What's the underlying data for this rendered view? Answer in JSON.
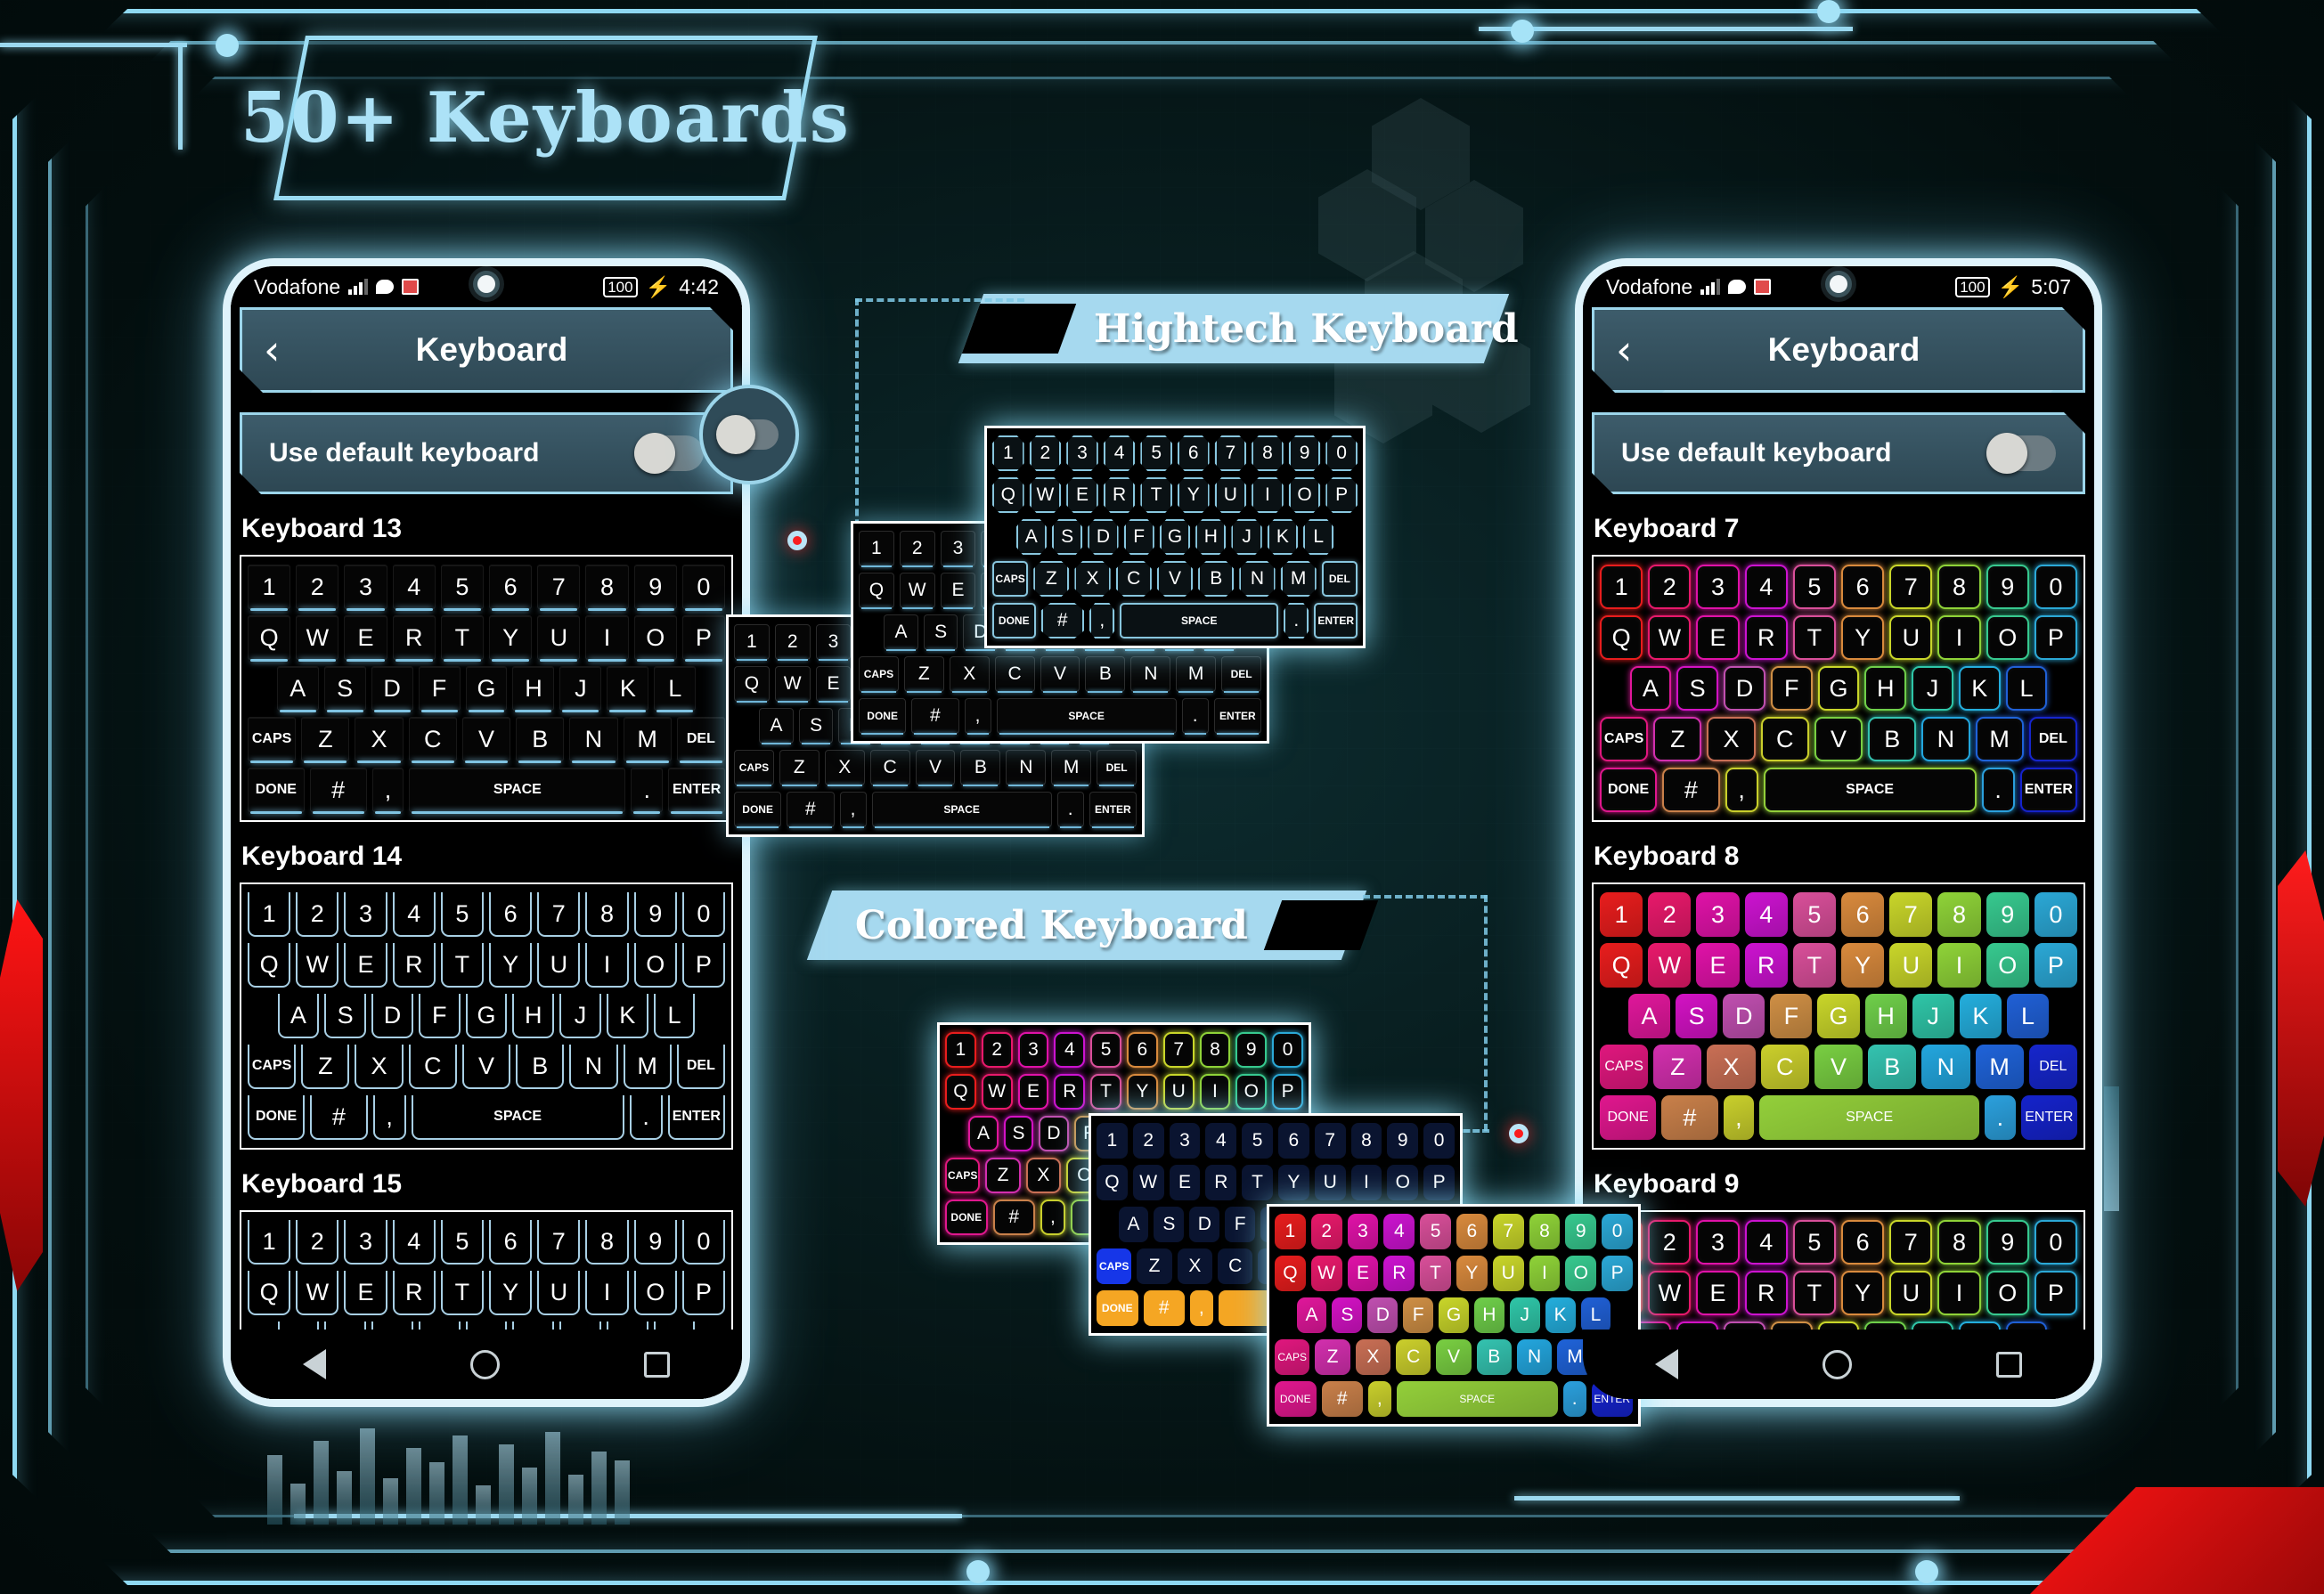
{
  "page": {
    "title": "50+ Keyboards",
    "accent_cyan": "#9bdcf3",
    "accent_red": "#ff1414",
    "bg": "#04100f"
  },
  "banners": [
    {
      "id": "hightech",
      "label": "Hightech Keyboard"
    },
    {
      "id": "colored",
      "label": "Colored Keyboard"
    }
  ],
  "phone_left": {
    "status": {
      "carrier": "Vodafone",
      "battery": "100",
      "time": "4:42"
    },
    "header": {
      "title": "Keyboard",
      "back_icon": "chevron-left-icon"
    },
    "default_row": {
      "label": "Use default keyboard",
      "toggle_state": "off"
    },
    "sections": [
      {
        "label": "Keyboard 13"
      },
      {
        "label": "Keyboard 14"
      },
      {
        "label": "Keyboard 15"
      }
    ]
  },
  "phone_right": {
    "status": {
      "carrier": "Vodafone",
      "battery": "100",
      "time": "5:07"
    },
    "header": {
      "title": "Keyboard",
      "back_icon": "chevron-left-icon"
    },
    "default_row": {
      "label": "Use default keyboard",
      "toggle_state": "off"
    },
    "sections": [
      {
        "label": "Keyboard 7"
      },
      {
        "label": "Keyboard 8"
      },
      {
        "label": "Keyboard 9"
      }
    ]
  },
  "keyboard_layout": {
    "row_numbers": [
      "1",
      "2",
      "3",
      "4",
      "5",
      "6",
      "7",
      "8",
      "9",
      "0"
    ],
    "row_top": [
      "Q",
      "W",
      "E",
      "R",
      "T",
      "Y",
      "U",
      "I",
      "O",
      "P"
    ],
    "row_home": [
      "A",
      "S",
      "D",
      "F",
      "G",
      "H",
      "J",
      "K",
      "L"
    ],
    "row_bottom": [
      "CAPS",
      "Z",
      "X",
      "C",
      "V",
      "B",
      "N",
      "M",
      "DEL"
    ],
    "row_action": [
      "DONE",
      "#",
      ",",
      "SPACE",
      ".",
      "ENTER"
    ]
  },
  "key_colors": {
    "rainbow": [
      "#e81d1d",
      "#e8196b",
      "#e012a8",
      "#cc13d0",
      "#d94f9a",
      "#d98a3d",
      "#c9d62a",
      "#8fd338",
      "#37c98f",
      "#2ba8d6"
    ],
    "rainbow_home": [
      "#e0179b",
      "#d312c4",
      "#c04fb0",
      "#cf8f45",
      "#c9d62a",
      "#6fcf4a",
      "#2fc6a8",
      "#24aedd",
      "#2060d6"
    ],
    "rainbow_bottom": [
      "#e0177e",
      "#d32fae",
      "#c96f55",
      "#cbcf2c",
      "#79cf42",
      "#34c3b0",
      "#23a6de",
      "#1f63d9",
      "#1626cc"
    ],
    "rainbow_action": [
      "#e0178e",
      "#c9804a",
      "#c9cf2c",
      "#93cf3a",
      "#2ba0dd",
      "#1523cb"
    ]
  },
  "navbar": {
    "back_icon": "triangle-back-icon",
    "home_icon": "circle-home-icon",
    "recents_icon": "square-recents-icon"
  }
}
